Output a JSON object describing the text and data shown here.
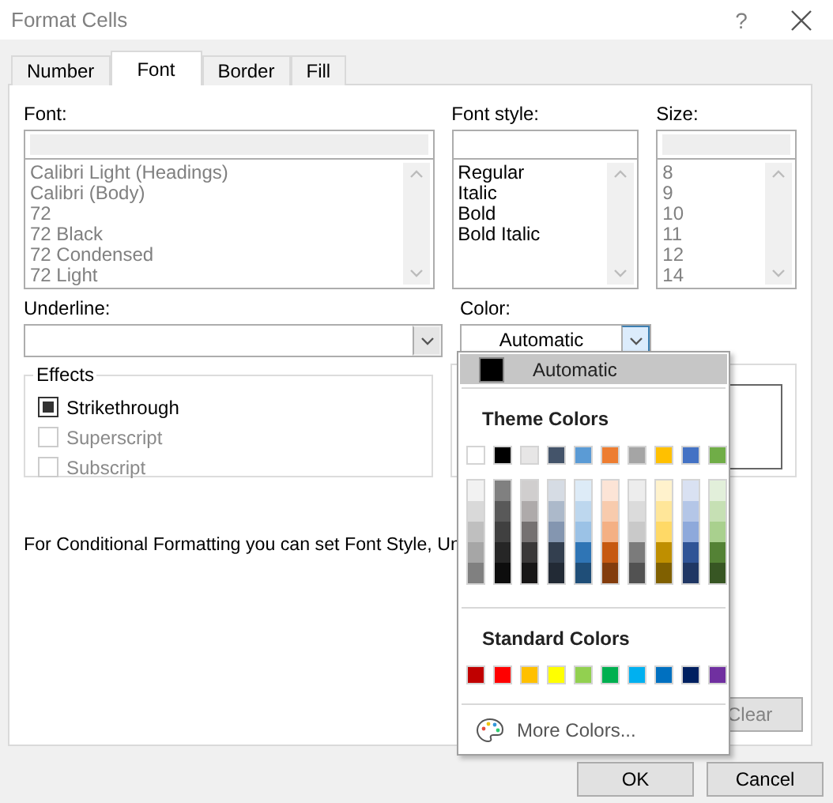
{
  "window": {
    "title": "Format Cells",
    "help": "?"
  },
  "tabs": [
    {
      "label": "Number",
      "selected": false
    },
    {
      "label": "Font",
      "selected": true
    },
    {
      "label": "Border",
      "selected": false
    },
    {
      "label": "Fill",
      "selected": false
    }
  ],
  "font": {
    "label": "Font:",
    "disabled": true,
    "items": [
      "Calibri Light (Headings)",
      "Calibri (Body)",
      "72",
      "72 Black",
      "72 Condensed",
      "72 Light"
    ]
  },
  "font_style": {
    "label": "Font style:",
    "disabled": false,
    "items": [
      "Regular",
      "Italic",
      "Bold",
      "Bold Italic"
    ]
  },
  "size": {
    "label": "Size:",
    "disabled": true,
    "items": [
      "8",
      "9",
      "10",
      "11",
      "12",
      "14"
    ]
  },
  "underline": {
    "label": "Underline:"
  },
  "color": {
    "label": "Color:",
    "value": "Automatic",
    "expanded": true
  },
  "effects": {
    "title": "Effects",
    "options": [
      {
        "label": "Strikethrough",
        "checked": true,
        "disabled": false
      },
      {
        "label": "Superscript",
        "checked": false,
        "disabled": true
      },
      {
        "label": "Subscript",
        "checked": false,
        "disabled": true
      }
    ]
  },
  "note": "For Conditional Formatting you can set Font Style, Un",
  "clear_button": "Clear",
  "color_menu": {
    "automatic": {
      "label": "Automatic",
      "color": "#000000"
    },
    "theme_heading": "Theme Colors",
    "theme_colors": [
      {
        "color": "#ffffff",
        "shades": [
          {
            "color": "#f2f2f2"
          },
          {
            "color": "#d9d9d9"
          },
          {
            "color": "#bfbfbf"
          },
          {
            "color": "#a6a6a6"
          },
          {
            "color": "#808080"
          }
        ]
      },
      {
        "color": "#000000",
        "shades": [
          {
            "color": "#808080"
          },
          {
            "color": "#595959"
          },
          {
            "color": "#404040"
          },
          {
            "color": "#262626"
          },
          {
            "color": "#0d0d0d"
          }
        ]
      },
      {
        "color": "#e7e6e6",
        "shades": [
          {
            "color": "#d0cece"
          },
          {
            "color": "#aeaaaa"
          },
          {
            "color": "#757171"
          },
          {
            "color": "#3a3838"
          },
          {
            "color": "#171616"
          }
        ]
      },
      {
        "color": "#44546a",
        "shades": [
          {
            "color": "#d6dce4"
          },
          {
            "color": "#acb9ca"
          },
          {
            "color": "#8496b0"
          },
          {
            "color": "#333f4f"
          },
          {
            "color": "#222a35"
          }
        ]
      },
      {
        "color": "#5b9bd5",
        "shades": [
          {
            "color": "#ddebf7"
          },
          {
            "color": "#bdd7ee"
          },
          {
            "color": "#9bc2e6"
          },
          {
            "color": "#2f75b5"
          },
          {
            "color": "#1f4e78"
          }
        ]
      },
      {
        "color": "#ed7d31",
        "shades": [
          {
            "color": "#fce4d6"
          },
          {
            "color": "#f8cbad"
          },
          {
            "color": "#f4b084"
          },
          {
            "color": "#c65911"
          },
          {
            "color": "#833c0c"
          }
        ]
      },
      {
        "color": "#a5a5a5",
        "shades": [
          {
            "color": "#ededed"
          },
          {
            "color": "#dbdbdb"
          },
          {
            "color": "#c9c9c9"
          },
          {
            "color": "#7b7b7b"
          },
          {
            "color": "#525252"
          }
        ]
      },
      {
        "color": "#ffc000",
        "shades": [
          {
            "color": "#fff2cc"
          },
          {
            "color": "#ffe699"
          },
          {
            "color": "#ffd966"
          },
          {
            "color": "#bf8f00"
          },
          {
            "color": "#806000"
          }
        ]
      },
      {
        "color": "#4472c4",
        "shades": [
          {
            "color": "#d9e1f2"
          },
          {
            "color": "#b4c6e7"
          },
          {
            "color": "#8ea9db"
          },
          {
            "color": "#305496"
          },
          {
            "color": "#203764"
          }
        ]
      },
      {
        "color": "#70ad47",
        "shades": [
          {
            "color": "#e2efda"
          },
          {
            "color": "#c6e0b4"
          },
          {
            "color": "#a9d08e"
          },
          {
            "color": "#548235"
          },
          {
            "color": "#375623"
          }
        ]
      }
    ],
    "standard_heading": "Standard Colors",
    "standard_colors": [
      {
        "color": "#c00000"
      },
      {
        "color": "#ff0000"
      },
      {
        "color": "#ffc000"
      },
      {
        "color": "#ffff00"
      },
      {
        "color": "#92d050"
      },
      {
        "color": "#00b050"
      },
      {
        "color": "#00b0f0"
      },
      {
        "color": "#0070c0"
      },
      {
        "color": "#002060"
      },
      {
        "color": "#7030a0"
      }
    ],
    "more_colors": "More Colors..."
  },
  "buttons": [
    "OK",
    "Cancel"
  ]
}
